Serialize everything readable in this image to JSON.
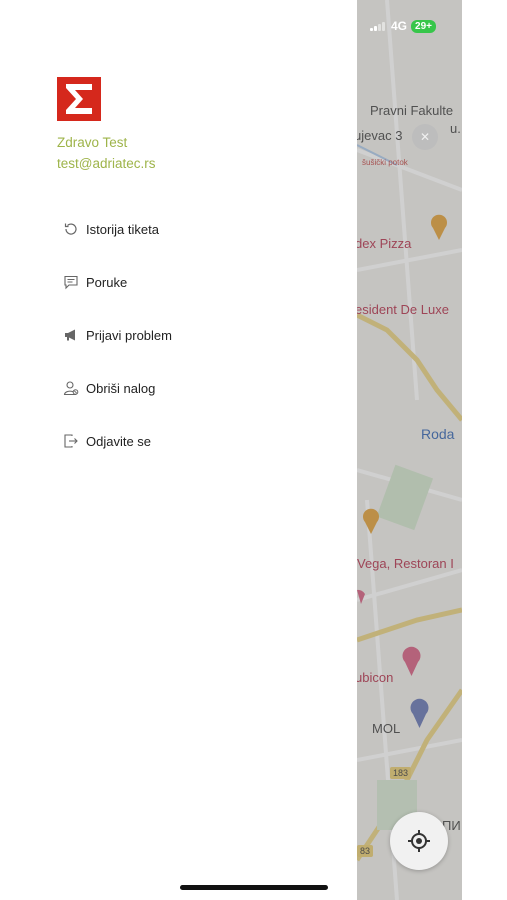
{
  "status": {
    "network": "4G",
    "battery": "29+"
  },
  "drawer": {
    "logo_icon": "sigma-logo-icon",
    "greeting": "Zdravo Test",
    "email": "test@adriatec.rs",
    "menu": [
      {
        "label": "Istorija tiketa",
        "icon": "history-icon"
      },
      {
        "label": "Poruke",
        "icon": "message-icon"
      },
      {
        "label": "Prijavi problem",
        "icon": "megaphone-icon"
      },
      {
        "label": "Obriši nalog",
        "icon": "delete-user-icon"
      },
      {
        "label": "Odjavite se",
        "icon": "logout-icon"
      }
    ]
  },
  "map": {
    "labels": {
      "pravni": "Pravni Fakulte",
      "pravni_u": "u.",
      "street": "ujevac 3",
      "stream": "šušički potok",
      "pizza": "dex Pizza",
      "hotel": "esident De Luxe",
      "roda": "Roda",
      "vega": "Vega, Restoran I",
      "bicon": "ubicon",
      "mol": "MOL",
      "road1": "183",
      "road2": "83",
      "cyr": "ПИ"
    },
    "colors": {
      "accent_green": "#9eb44a",
      "logo_red": "#d5281c",
      "battery_green": "#37c64a"
    }
  }
}
